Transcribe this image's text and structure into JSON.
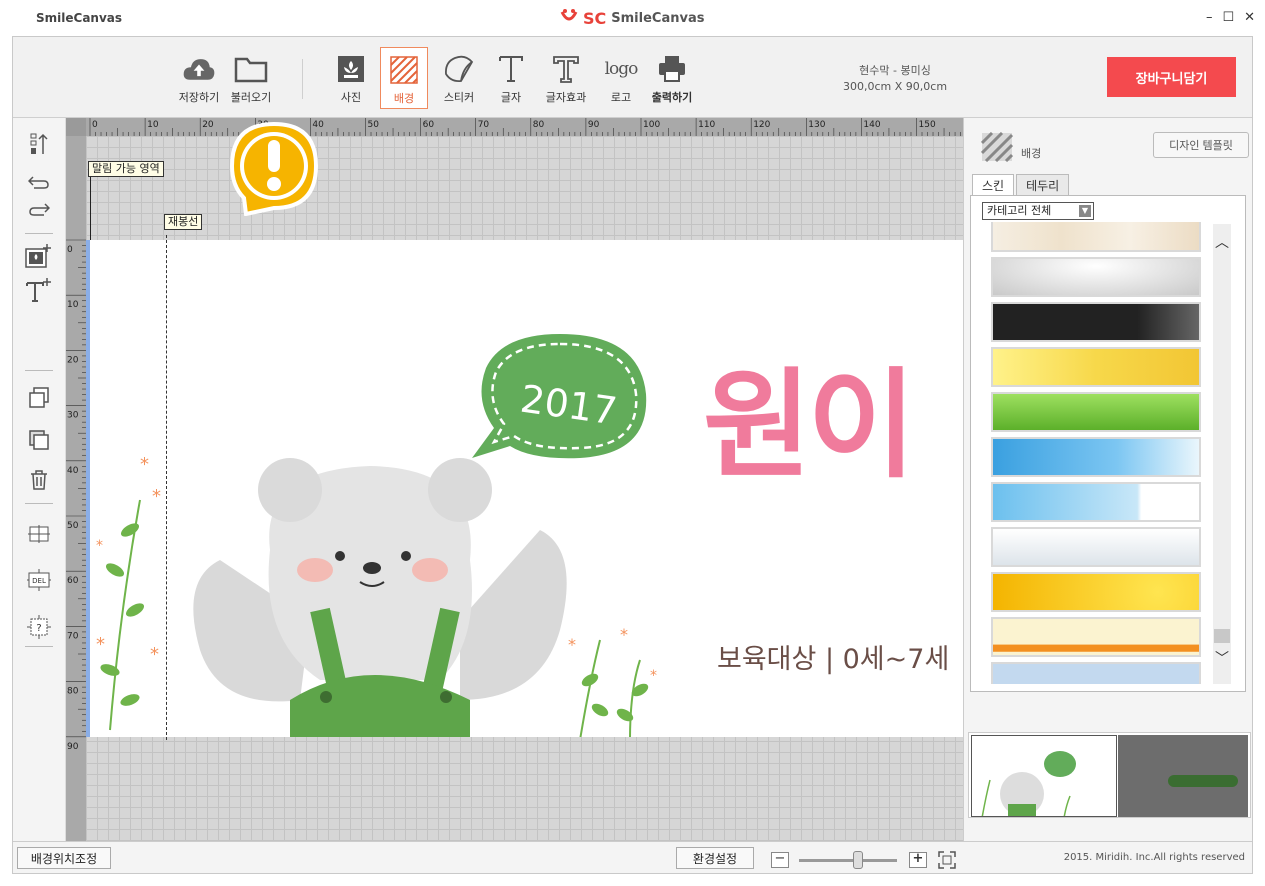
{
  "app": {
    "title_left": "SmileCanvas",
    "logo_mark": "SC",
    "logo_name": "SmileCanvas",
    "window_controls": [
      "–",
      "☐",
      "✕"
    ]
  },
  "toolbar": {
    "items": [
      {
        "label": "저장하기",
        "icon": "cloud-upload-icon"
      },
      {
        "label": "불러오기",
        "icon": "folder-icon"
      },
      {
        "label": "사진",
        "icon": "photo-icon"
      },
      {
        "label": "배경",
        "icon": "background-icon",
        "active": true
      },
      {
        "label": "스티커",
        "icon": "sticker-icon"
      },
      {
        "label": "글자",
        "icon": "text-icon"
      },
      {
        "label": "글자효과",
        "icon": "text-effect-icon"
      },
      {
        "label": "로고",
        "icon": "logo-icon"
      },
      {
        "label": "출력하기",
        "icon": "print-icon"
      }
    ],
    "logo_glyph": "logo",
    "product_name": "현수막 - 봉미싱",
    "product_size": "300,0cm X 90,0cm",
    "cart_label": "장바구니담기"
  },
  "left_tools": [
    "align-icon",
    "undo-icon",
    "redo-icon",
    "add-photo-icon",
    "add-text-icon",
    "copy-icon",
    "layer-icon",
    "trash-icon",
    "grid-icon",
    "delete-guide-icon",
    "help-icon"
  ],
  "canvas": {
    "bleed_label": "말림 가능 영역",
    "sew_label": "재봉선",
    "ruler_top_labels": [
      "0",
      "10",
      "20",
      "30",
      "40",
      "50",
      "60",
      "70",
      "80",
      "90",
      "100",
      "110",
      "120",
      "130",
      "140",
      "150"
    ],
    "ruler_left_labels": [
      "0",
      "10",
      "20",
      "30",
      "40",
      "50",
      "60",
      "70",
      "80",
      "90"
    ],
    "bubble_year": "2017",
    "headline_text": "원이",
    "subtitle": "보육대상 | 0세~7세"
  },
  "right_panel": {
    "header_label": "배경",
    "template_button": "디자인 템플릿",
    "tabs": [
      {
        "label": "스킨",
        "active": true
      },
      {
        "label": "테두리",
        "active": false
      }
    ],
    "category_select": "카테고리 전체",
    "swatches": [
      {
        "name": "beige-wood"
      },
      {
        "name": "silver-light"
      },
      {
        "name": "black-gradient"
      },
      {
        "name": "yellow-floral"
      },
      {
        "name": "green-gradient"
      },
      {
        "name": "blue-sky-cloud"
      },
      {
        "name": "light-blue-fade"
      },
      {
        "name": "pale-blue-map"
      },
      {
        "name": "yellow-sunburst"
      },
      {
        "name": "cream-orange-stripe"
      },
      {
        "name": "light-blue-partial"
      }
    ]
  },
  "bottom_bar": {
    "bg_adjust_label": "배경위치조정",
    "settings_label": "환경설정",
    "zoom_minus": "−",
    "zoom_plus": "+",
    "zoom_level": 0.6,
    "copyright": "2015. Miridih. Inc.All rights reserved"
  },
  "colors": {
    "accent_red": "#f44a4e",
    "active_orange": "#e4643a",
    "title_pink": "#f07b9c",
    "bubble_green": "#62ac5a"
  }
}
